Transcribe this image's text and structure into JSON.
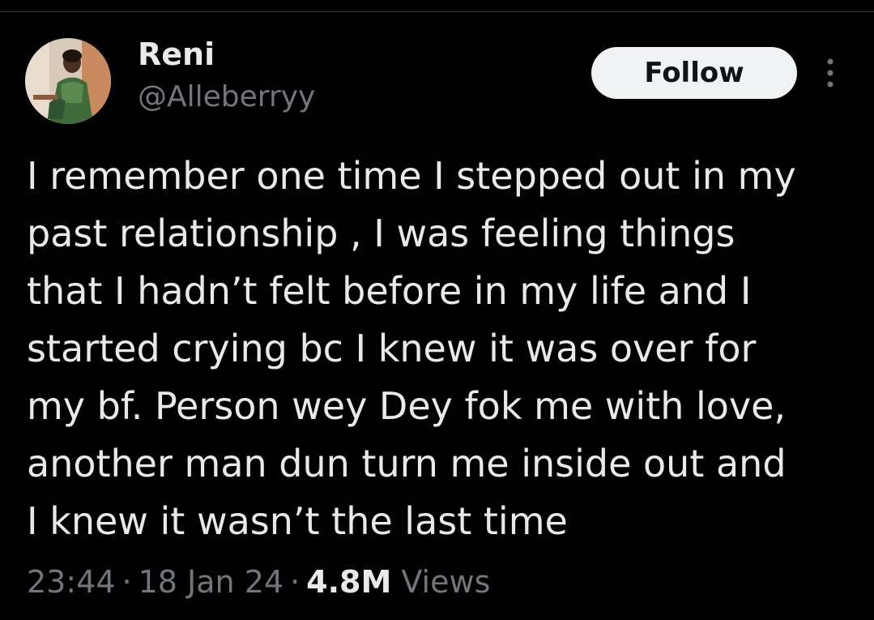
{
  "author": {
    "display_name": "Reni",
    "handle": "@Alleberryy"
  },
  "actions": {
    "follow_label": "Follow",
    "more_icon": "more-vertical-icon"
  },
  "tweet": {
    "text": "I remember one time I stepped out in my\npast relationship , I was feeling things\nthat I hadn’t felt before in my life and I\nstarted crying bc I knew it was over for\nmy bf. Person wey Dey fok me with love,\nanother man dun turn me inside out and\nI knew it wasn’t the last time"
  },
  "meta": {
    "time": "23:44",
    "separator": "·",
    "date": "18 Jan 24",
    "views_count": "4.8M",
    "views_label": "Views"
  },
  "colors": {
    "background": "#000000",
    "primary_text": "#e7e9ea",
    "secondary_text": "#71767b",
    "follow_bg": "#eff3f4",
    "follow_text": "#0f1419"
  }
}
